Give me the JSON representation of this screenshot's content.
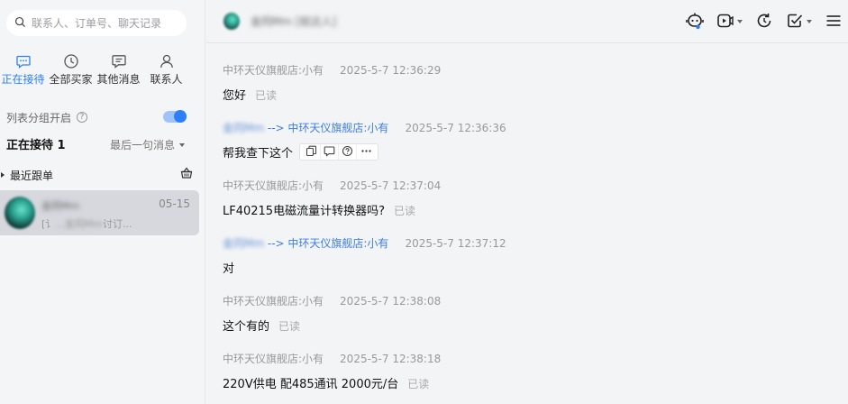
{
  "search": {
    "placeholder": "联系人、订单号、聊天记录",
    "icon": "search-icon"
  },
  "tabs": [
    {
      "label": "正在接待",
      "icon": "chat-bubble-icon",
      "active": true
    },
    {
      "label": "全部买家",
      "icon": "clock-icon",
      "active": false
    },
    {
      "label": "其他消息",
      "icon": "message-icon",
      "active": false
    },
    {
      "label": "联系人",
      "icon": "person-icon",
      "active": false
    }
  ],
  "list_group": {
    "label": "列表分组开启",
    "help": "?",
    "toggle_on": true
  },
  "status": {
    "title": "正在接待 1",
    "sort_label": "最后一句消息"
  },
  "recent": {
    "label": "最近跟单"
  },
  "contact": {
    "name": "金同Mm",
    "time": "05-15",
    "msg_prefix": "[讠",
    "msg_blur": "...金同Mm",
    "msg_suffix": "讨订..."
  },
  "header": {
    "name": "金同Mm [就达人]"
  },
  "toolbar_icons": [
    "robot-icon",
    "video-icon",
    "refresh-icon",
    "checklist-icon",
    "menu-icon"
  ],
  "accent_color": "#2d7ff9",
  "messages": [
    {
      "sender": "中环天仪旗舰店:小有",
      "time": "2025-5-7 12:36:29",
      "text": "您好",
      "read": "已读",
      "incoming": false
    },
    {
      "sender_blur": "金同Mm",
      "arrow": " --> ",
      "to": "中环天仪旗舰店:小有",
      "time": "2025-5-7 12:36:36",
      "text": "帮我查下这个",
      "incoming": true
    },
    {
      "sender": "中环天仪旗舰店:小有",
      "time": "2025-5-7 12:37:04",
      "text": "LF40215电磁流量计转换器吗?",
      "read": "已读",
      "incoming": false
    },
    {
      "sender_blur": "金同Mm",
      "arrow": " --> ",
      "to": "中环天仪旗舰店:小有",
      "time": "2025-5-7 12:37:12",
      "text": "对",
      "incoming": true
    },
    {
      "sender": "中环天仪旗舰店:小有",
      "time": "2025-5-7 12:38:08",
      "text": "这个有的",
      "read": "已读",
      "incoming": false
    },
    {
      "sender": "中环天仪旗舰店:小有",
      "time": "2025-5-7 12:38:18",
      "text": "220V供电 配485通讯 2000元/台",
      "read": "已读",
      "incoming": false
    }
  ]
}
